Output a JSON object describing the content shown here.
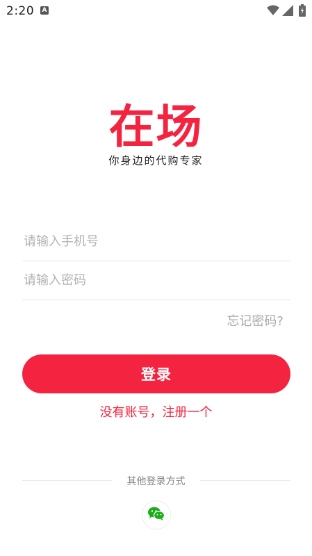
{
  "status_bar": {
    "time": "2:20",
    "notification_icon": "a-icon",
    "icons": [
      "wifi-icon",
      "signal-icon",
      "battery-charging-icon"
    ]
  },
  "brand": {
    "logo_text": "在场",
    "tagline": "你身边的代购专家",
    "color": "#f42441"
  },
  "form": {
    "phone_placeholder": "请输入手机号",
    "password_placeholder": "请输入密码",
    "forgot_label": "忘记密码?",
    "login_label": "登录",
    "register_label": "没有账号，注册一个"
  },
  "other_login": {
    "label": "其他登录方式",
    "wechat_icon": "wechat-icon",
    "wechat_color": "#1aad19"
  }
}
